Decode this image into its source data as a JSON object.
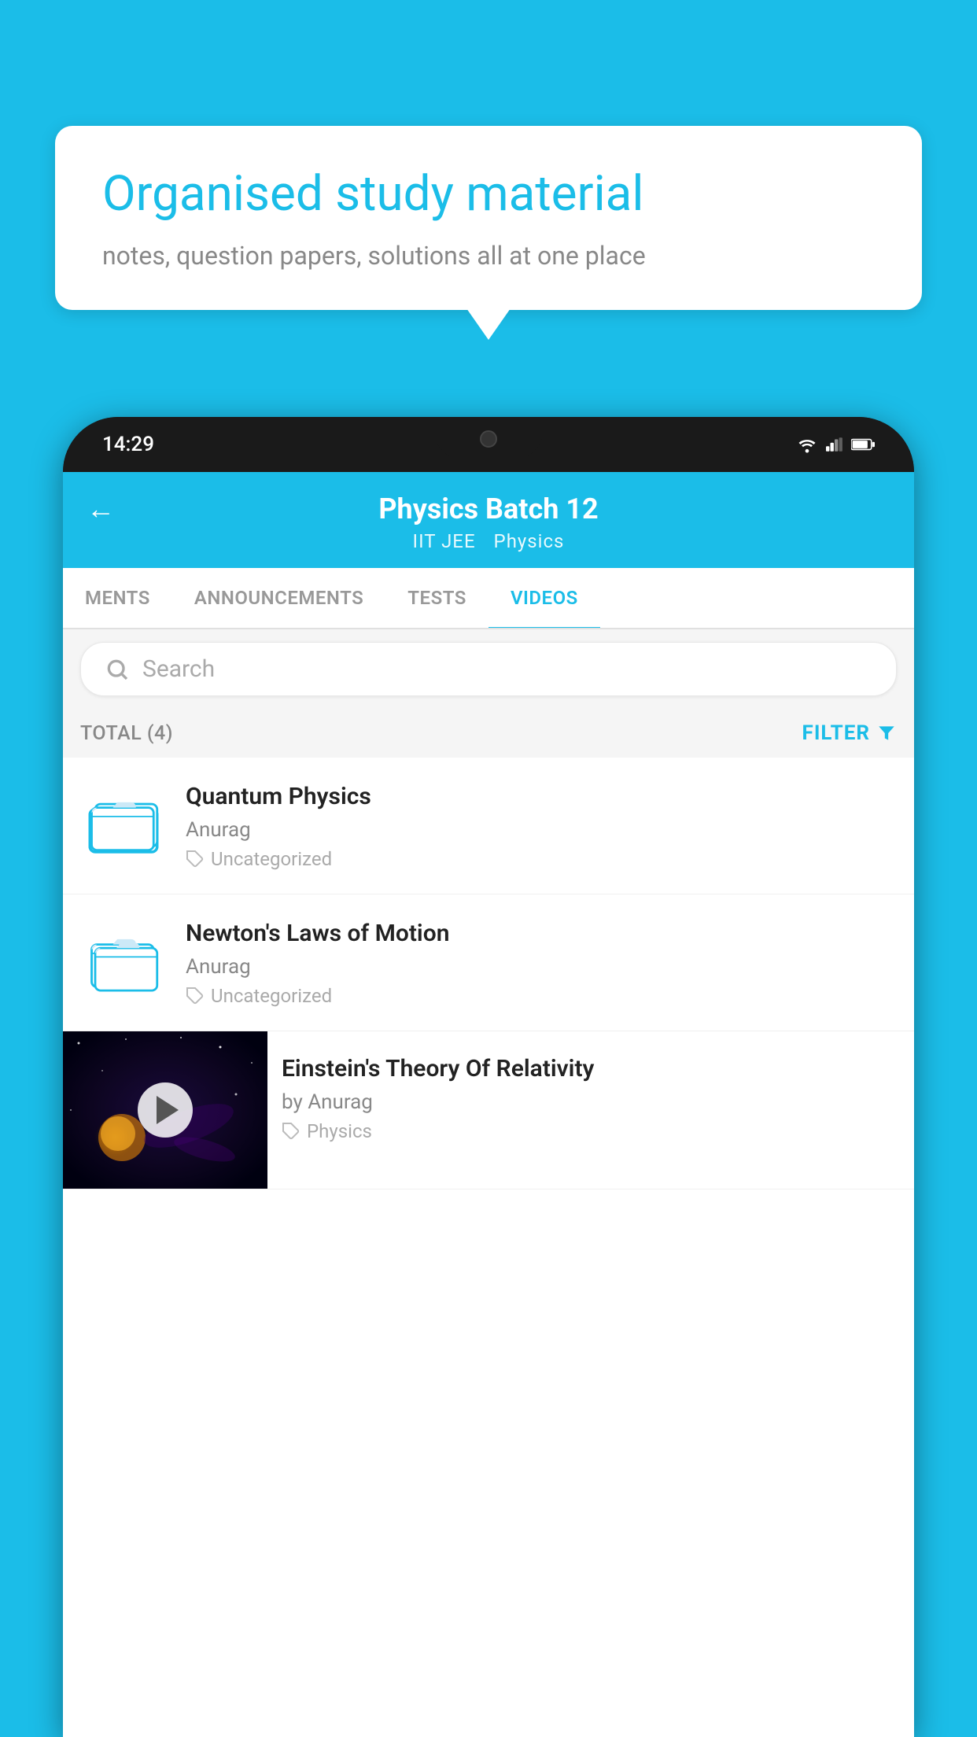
{
  "background_color": "#1BBDE8",
  "speech_bubble": {
    "title": "Organised study material",
    "subtitle": "notes, question papers, solutions all at one place"
  },
  "phone": {
    "time": "14:29",
    "header": {
      "back_label": "←",
      "title": "Physics Batch 12",
      "subtitle_tag1": "IIT JEE",
      "subtitle_tag2": "Physics"
    },
    "tabs": [
      {
        "label": "MENTS",
        "active": false
      },
      {
        "label": "ANNOUNCEMENTS",
        "active": false
      },
      {
        "label": "TESTS",
        "active": false
      },
      {
        "label": "VIDEOS",
        "active": true
      }
    ],
    "search": {
      "placeholder": "Search"
    },
    "filter_bar": {
      "total_label": "TOTAL (4)",
      "filter_label": "FILTER"
    },
    "videos": [
      {
        "id": 1,
        "title": "Quantum Physics",
        "author": "Anurag",
        "tag": "Uncategorized",
        "has_thumbnail": false
      },
      {
        "id": 2,
        "title": "Newton's Laws of Motion",
        "author": "Anurag",
        "tag": "Uncategorized",
        "has_thumbnail": false
      },
      {
        "id": 3,
        "title": "Einstein's Theory Of Relativity",
        "author": "by Anurag",
        "tag": "Physics",
        "has_thumbnail": true
      }
    ]
  }
}
